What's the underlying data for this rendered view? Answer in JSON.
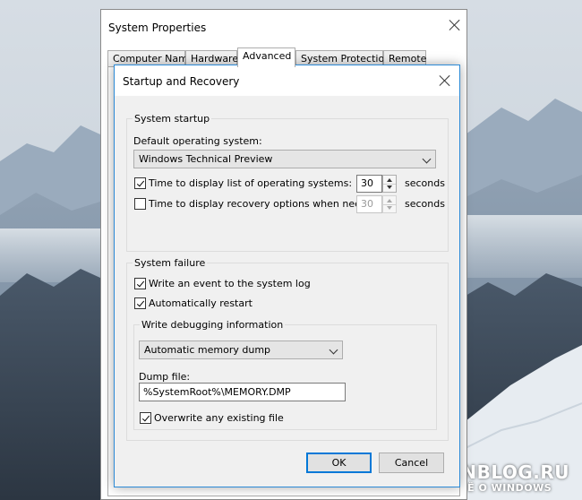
{
  "system_properties": {
    "title": "System Properties",
    "tabs": [
      {
        "label": "Computer Name"
      },
      {
        "label": "Hardware"
      },
      {
        "label": "Advanced"
      },
      {
        "label": "System Protection"
      },
      {
        "label": "Remote"
      }
    ],
    "active_tab": "Advanced"
  },
  "startup_recovery": {
    "title": "Startup and Recovery",
    "system_startup": {
      "legend": "System startup",
      "default_os_label": "Default operating system:",
      "default_os_value": "Windows Technical Preview",
      "time_os_list": {
        "label": "Time to display list of operating systems:",
        "checked": true,
        "value": "30",
        "unit": "seconds"
      },
      "time_recovery": {
        "label": "Time to display recovery options when needed:",
        "checked": false,
        "value": "30",
        "unit": "seconds"
      }
    },
    "system_failure": {
      "legend": "System failure",
      "write_event": {
        "label": "Write an event to the system log",
        "checked": true
      },
      "auto_restart": {
        "label": "Automatically restart",
        "checked": true
      },
      "debug": {
        "legend": "Write debugging information",
        "dump_type": "Automatic memory dump",
        "dump_file_label": "Dump file:",
        "dump_file_value": "%SystemRoot%\\MEMORY.DMP",
        "overwrite": {
          "label": "Overwrite any existing file",
          "checked": true
        }
      }
    },
    "buttons": {
      "ok": "OK",
      "cancel": "Cancel"
    }
  },
  "watermark": {
    "line1": "WINBLOG.RU",
    "line2": "ВСЁ О WINDOWS"
  },
  "colors": {
    "accent_border": "#2c8ad6",
    "default_button": "#0078d7",
    "dialog_bg": "#f0f0f0"
  }
}
